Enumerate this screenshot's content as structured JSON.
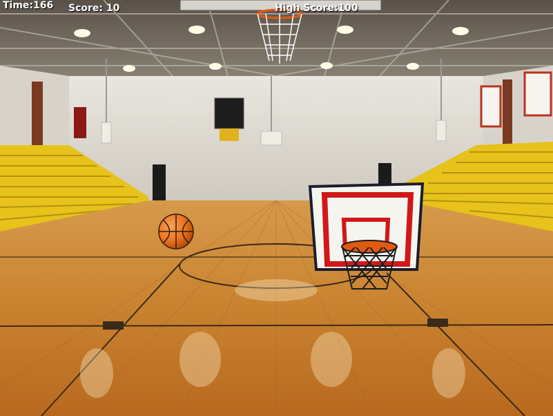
{
  "hud": {
    "time_label": "Time:",
    "time_value": "166",
    "score_label": "Score:",
    "score_value": "10",
    "high_label": "High Score:",
    "high_value": "100"
  },
  "colors": {
    "floor_light": "#e2a24a",
    "floor_dark": "#a9621e",
    "bleacher_yellow": "#e6c21a",
    "wall": "#dcd8cf",
    "ceiling": "#6f665c",
    "backboard_red": "#d01818",
    "ball_orange": "#e8731e",
    "rim_orange": "#e05a10"
  },
  "icons": {
    "ball": "basketball-icon",
    "hoop": "hoop-icon"
  }
}
